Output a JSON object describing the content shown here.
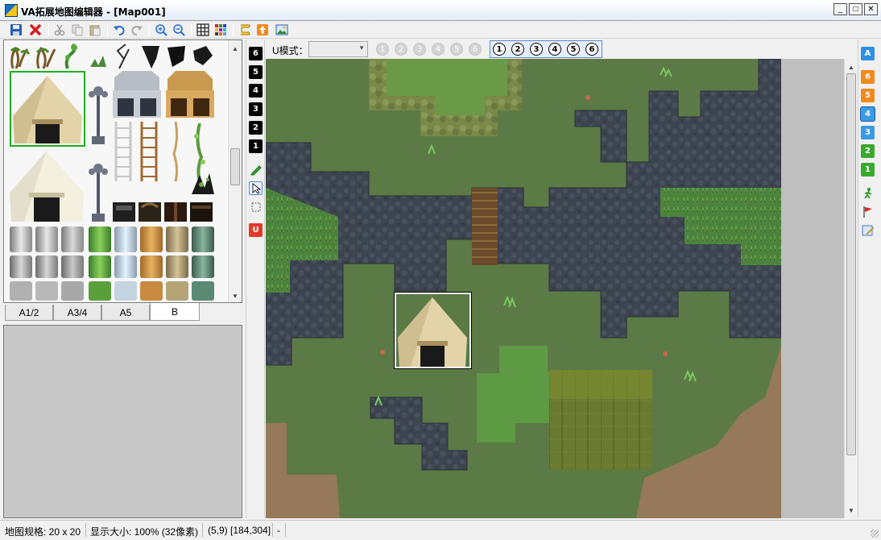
{
  "window": {
    "title": "VA拓展地图编辑器 - [Map001]",
    "min_label": "_",
    "max_label": "□",
    "close_label": "✕"
  },
  "toolbar": {
    "icons": [
      "save-icon",
      "delete-icon",
      "cut-icon",
      "copy-icon",
      "paste-icon",
      "undo-icon",
      "redo-icon",
      "zoom-in-icon",
      "zoom-out-icon",
      "grid-icon",
      "palette-icon",
      "script-icon",
      "upload-icon",
      "image-icon"
    ]
  },
  "tileset": {
    "tabs": [
      {
        "label": "A1/2",
        "active": false
      },
      {
        "label": "A3/4",
        "active": false
      },
      {
        "label": "A5",
        "active": false
      },
      {
        "label": "B",
        "active": true
      }
    ]
  },
  "layers": {
    "numbers": [
      "6",
      "5",
      "4",
      "3",
      "2",
      "1"
    ],
    "tool_u_label": "U"
  },
  "mode_bar": {
    "label": "U模式：",
    "select_value": "",
    "dim_buttons": [
      "1",
      "2",
      "3",
      "4",
      "5",
      "6"
    ],
    "active_buttons": [
      "1",
      "2",
      "3",
      "4",
      "5",
      "6"
    ]
  },
  "right_layers": {
    "items": [
      {
        "label": "A",
        "color": "#2f8fe0"
      },
      {
        "label": "6",
        "color": "#f08a1c"
      },
      {
        "label": "5",
        "color": "#f08a1c"
      },
      {
        "label": "4",
        "color": "#3a9ae4"
      },
      {
        "label": "3",
        "color": "#3a9ae4"
      },
      {
        "label": "2",
        "color": "#3aaa2e"
      },
      {
        "label": "1",
        "color": "#3aaa2e"
      }
    ]
  },
  "status": {
    "map_size": "地图规格: 20 x 20",
    "zoom": "显示大小: 100% (32像素)",
    "coords": "(5,9) [184,304]",
    "extra": "-"
  }
}
